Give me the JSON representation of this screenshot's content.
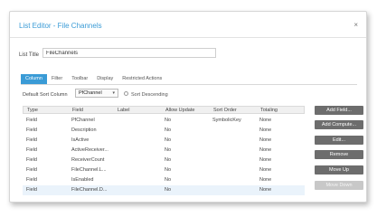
{
  "dialog": {
    "title": "List Editor - File Channels",
    "close_glyph": "×"
  },
  "list_title": {
    "label": "List Title",
    "value": "FileChannels"
  },
  "tabs": [
    {
      "label": "Column",
      "active": true
    },
    {
      "label": "Filter",
      "active": false
    },
    {
      "label": "Toolbar",
      "active": false
    },
    {
      "label": "Display",
      "active": false
    },
    {
      "label": "Restricted Actions",
      "active": false
    }
  ],
  "sort": {
    "default_label": "Default Sort Column",
    "selected": "PfChannel",
    "caret": "▾",
    "descending_label": "Sort Descending"
  },
  "grid": {
    "columns": [
      "Type",
      "Field",
      "Label",
      "Allow Update",
      "Sort Order",
      "Totaling"
    ],
    "rows": [
      [
        "Field",
        "PfChannel",
        "",
        "No",
        "SymbolicKey",
        "None"
      ],
      [
        "Field",
        "Description",
        "",
        "No",
        "",
        "None"
      ],
      [
        "Field",
        "IsActive",
        "",
        "No",
        "",
        "None"
      ],
      [
        "Field",
        "ActiveReceiver...",
        "",
        "No",
        "",
        "None"
      ],
      [
        "Field",
        "ReceiverCount",
        "",
        "No",
        "",
        "None"
      ],
      [
        "Field",
        "FileChannel.L...",
        "",
        "No",
        "",
        "None"
      ],
      [
        "Field",
        "IsEnabled",
        "",
        "No",
        "",
        "None"
      ],
      [
        "Field",
        "FileChannel.D...",
        "",
        "No",
        "",
        "None"
      ]
    ],
    "selected_row": 7
  },
  "buttons": {
    "add_field": "Add Field...",
    "add_compute": "Add Compute...",
    "edit": "Edit...",
    "remove": "Remove",
    "move_up": "Move Up",
    "move_down": "Move Down"
  },
  "colors": {
    "accent": "#3a9bd6",
    "button": "#6d6d6d",
    "button_disabled": "#c8c8c8"
  }
}
